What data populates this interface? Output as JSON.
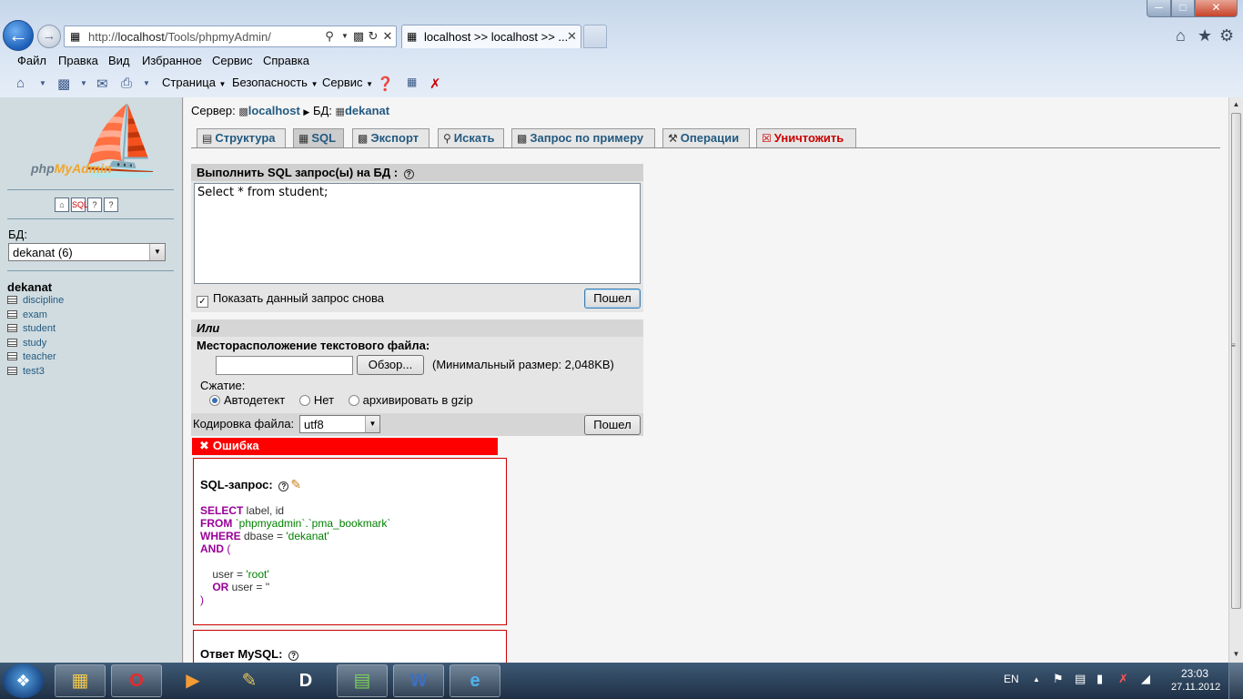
{
  "browser": {
    "url_prefix": "http://",
    "url_host": "localhost",
    "url_path": "/Tools/phpmyAdmin/",
    "tab_title": "localhost >> localhost >> ...",
    "menu": [
      "Файл",
      "Правка",
      "Вид",
      "Избранное",
      "Сервис",
      "Справка"
    ],
    "command_bar": [
      "Страница",
      "Безопасность",
      "Сервис"
    ]
  },
  "sidebar": {
    "logo_prefix": "php",
    "logo_accent": "MyAdmin",
    "db_label": "БД:",
    "db_selected": "dekanat (6)",
    "db_name": "dekanat",
    "tables": [
      "discipline",
      "exam",
      "student",
      "study",
      "teacher",
      "test3"
    ]
  },
  "breadcrumb": {
    "server_label": "Сервер:",
    "server": "localhost",
    "db_label": "БД:",
    "db": "dekanat"
  },
  "tabs": [
    {
      "label": "Структура",
      "icon": "structure-icon"
    },
    {
      "label": "SQL",
      "icon": "sql-icon"
    },
    {
      "label": "Экспорт",
      "icon": "export-icon"
    },
    {
      "label": "Искать",
      "icon": "search-icon"
    },
    {
      "label": "Запрос по примеру",
      "icon": "query-icon"
    },
    {
      "label": "Операции",
      "icon": "operations-icon"
    },
    {
      "label": "Уничтожить",
      "icon": "drop-icon"
    }
  ],
  "sql_form": {
    "header": "Выполнить SQL запрос(ы) на БД :",
    "query": "Select * from student;",
    "show_again": "Показать данный запрос снова",
    "go": "Пошел"
  },
  "file_form": {
    "or": "Или",
    "location_label": "Месторасположение текстового файла:",
    "browse": "Обзор...",
    "min_size": "(Минимальный размер: 2,048KB)",
    "compression_label": "Сжатие:",
    "compression_options": [
      "Автодетект",
      "Нет",
      "архивировать в gzip"
    ],
    "encoding_label": "Кодировка файла:",
    "encoding_value": "utf8",
    "go": "Пошел"
  },
  "error": {
    "title": "Ошибка",
    "sql_label": "SQL-запрос:",
    "response_label": "Ответ MySQL:",
    "code": {
      "select_kw": "SELECT",
      "select_rest": " label, id",
      "from_kw": "FROM",
      "from_rest": " `phpmyadmin`.`pma_bookmark`",
      "where_kw": "WHERE",
      "where_field": " dbase = ",
      "where_val": "'dekanat'",
      "and_kw": "AND",
      "paren_open": " (",
      "user_field": "    user = ",
      "user_val": "'root'",
      "or_kw": "    OR",
      "or_rest": " user = ''",
      "paren_close": ")"
    }
  },
  "taskbar": {
    "lang": "EN",
    "time": "23:03",
    "date": "27.11.2012"
  }
}
